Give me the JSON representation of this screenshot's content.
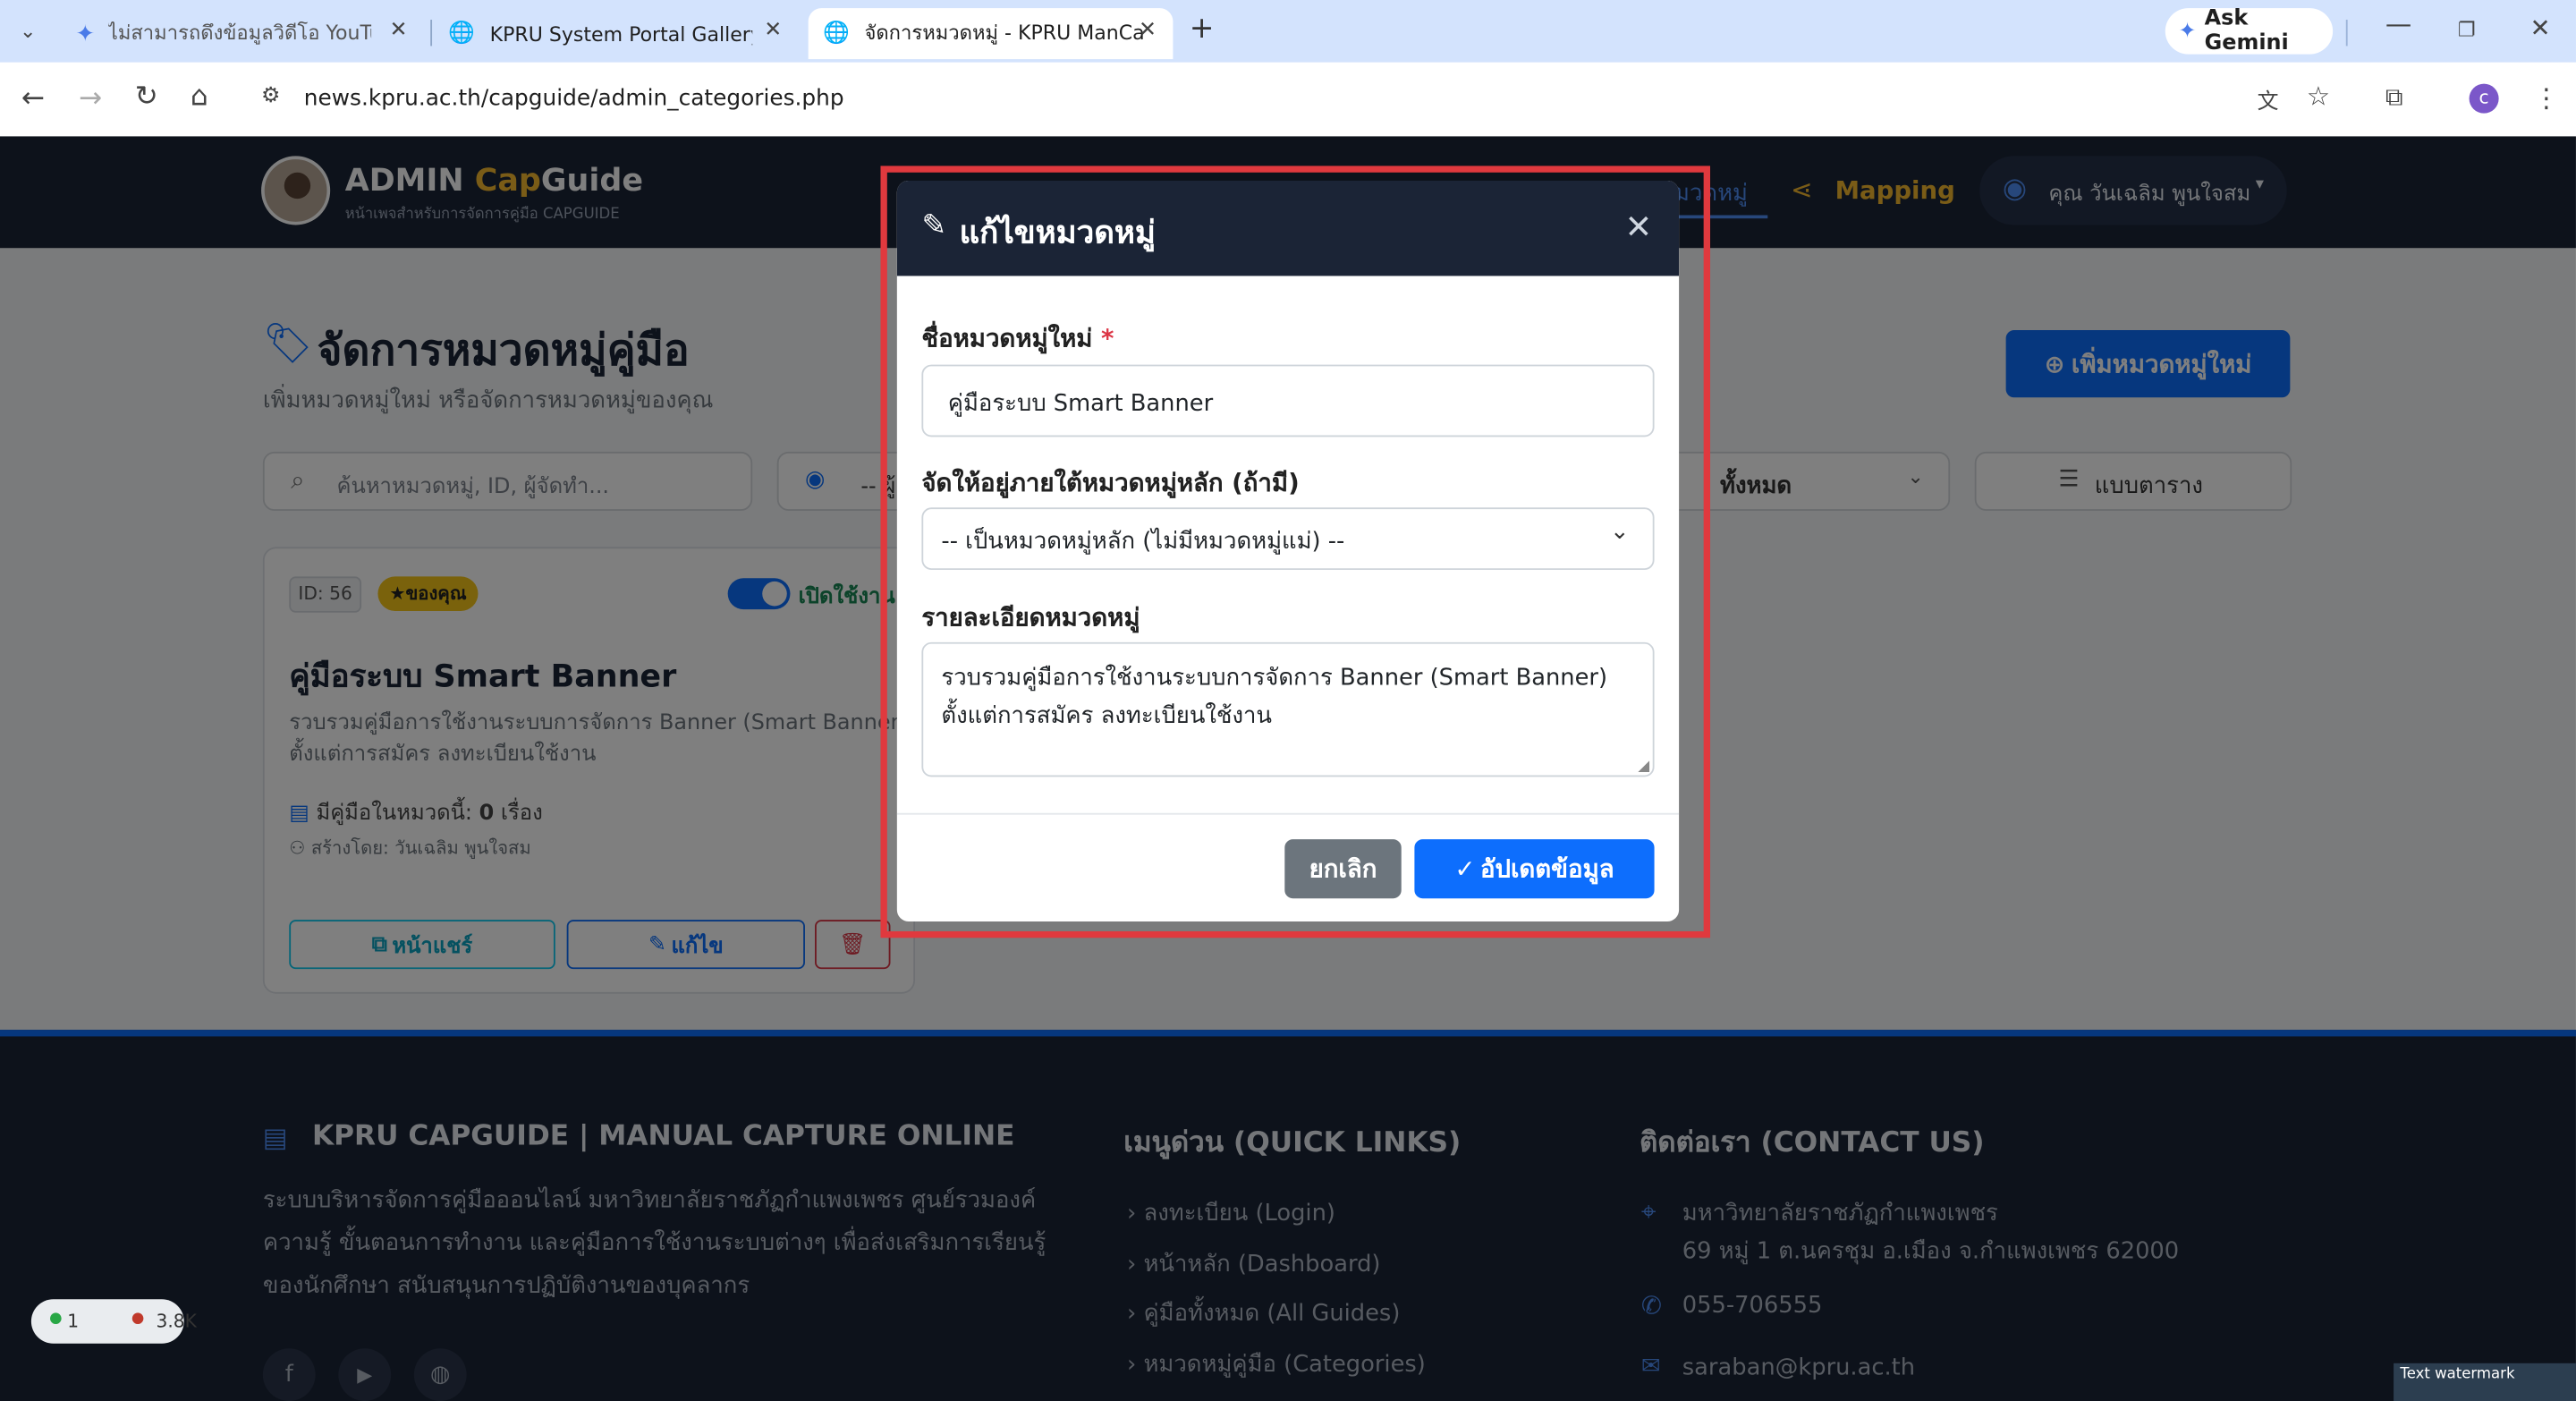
{
  "browser": {
    "tabs": [
      {
        "title": "ไม่สามารถดึงข้อมูลวิดีโอ YouTube"
      },
      {
        "title": "KPRU System Portal Gallery"
      },
      {
        "title": "จัดการหมวดหมู่ - KPRU ManCap"
      }
    ],
    "new_tab": "+",
    "ask_gemini": "Ask Gemini",
    "url": "news.kpru.ac.th/capguide/admin_categories.php",
    "profile_initial": "c"
  },
  "navbar": {
    "brand_prefix": "ADMIN ",
    "brand_cap": "Cap",
    "brand_suffix": "Guide",
    "brand_sub": "หน้าเพจสำหรับการจัดการคู่มือ CAPGUIDE",
    "active_item": "หมวดหมู่",
    "mapping": "Mapping",
    "user": "คุณ วันเฉลิม พูนใจสม"
  },
  "page": {
    "title": "จัดการหมวดหมู่คู่มือ",
    "subtitle": "เพิ่มหมวดหมู่ใหม่ หรือจัดการหมวดหมู่ของคุณ",
    "add_button": "เพิ่มหมวดหมู่ใหม่",
    "search_placeholder": "ค้นหาหมวดหมู่, ID, ผู้จัดทำ...",
    "owner_filter": "-- ผู้",
    "status_filter": "ทั้งหมด",
    "view_toggle": "แบบตาราง"
  },
  "card": {
    "id_badge": "ID: 56",
    "owner_badge": "ของคุณ",
    "toggle_label": "เปิดใช้งาน",
    "title": "คู่มือระบบ Smart Banner",
    "desc_line1": "รวบรวมคู่มือการใช้งานระบบการจัดการ Banner (Smart Banner)",
    "desc_line2": "ตั้งแต่การสมัคร ลงทะเบียนใช้งาน",
    "count_prefix": "มีคู่มือในหมวดนี้:",
    "count_value": "0",
    "count_suffix": "เรื่อง",
    "creator": "สร้างโดย: วันเฉลิม พูนใจสม",
    "share_button": "หน้าแชร์",
    "edit_button": "แก้ไข"
  },
  "modal": {
    "title": "แก้ไขหมวดหมู่",
    "name_label": "ชื่อหมวดหมู่ใหม่",
    "required_mark": "*",
    "name_value": "คู่มือระบบ Smart Banner",
    "parent_label": "จัดให้อยู่ภายใต้หมวดหมู่หลัก (ถ้ามี)",
    "parent_value": "-- เป็นหมวดหมู่หลัก (ไม่มีหมวดหมู่แม่) --",
    "desc_label": "รายละเอียดหมวดหมู่",
    "desc_line1": "รวบรวมคู่มือการใช้งานระบบการจัดการ Banner (Smart Banner)",
    "desc_line2": "ตั้งแต่การสมัคร ลงทะเบียนใช้งาน",
    "cancel": "ยกเลิก",
    "submit": "อัปเดตข้อมูล"
  },
  "footer": {
    "brand": "KPRU CAPGUIDE | MANUAL CAPTURE ONLINE",
    "about_lines": [
      "ระบบบริหารจัดการคู่มือออนไลน์ มหาวิทยาลัยราชภัฏกำแพงเพชร ศูนย์รวมองค์",
      "ความรู้ ขั้นตอนการทำงาน และคู่มือการใช้งานระบบต่างๆ เพื่อส่งเสริมการเรียนรู้",
      "ของนักศึกษา สนับสนุนการปฏิบัติงานของบุคลากร"
    ],
    "quick_title": "เมนูด่วน (QUICK LINKS)",
    "quick_links": [
      "ลงทะเบียน (Login)",
      "หน้าหลัก (Dashboard)",
      "คู่มือทั้งหมด (All Guides)",
      "หมวดหมู่คู่มือ (Categories)"
    ],
    "contact_title": "ติดต่อเรา (CONTACT US)",
    "address_line1": "มหาวิทยาลัยราชภัฏกำแพงเพชร",
    "address_line2": "69 หมู่ 1 ต.นครชุม อ.เมือง จ.กำแพงเพชร 62000",
    "phone": "055-706555",
    "email": "saraban@kpru.ac.th"
  },
  "stats_widget": {
    "online": "1",
    "views": "3.8K"
  },
  "watermark": "Text watermark",
  "colors": {
    "primary": "#0d6efd",
    "navbar": "#1b2436",
    "brand_accent": "#f5b82e",
    "mapping": "#f5b82e",
    "highlight": "#e0393e",
    "success": "#198754",
    "danger": "#dc3545"
  }
}
